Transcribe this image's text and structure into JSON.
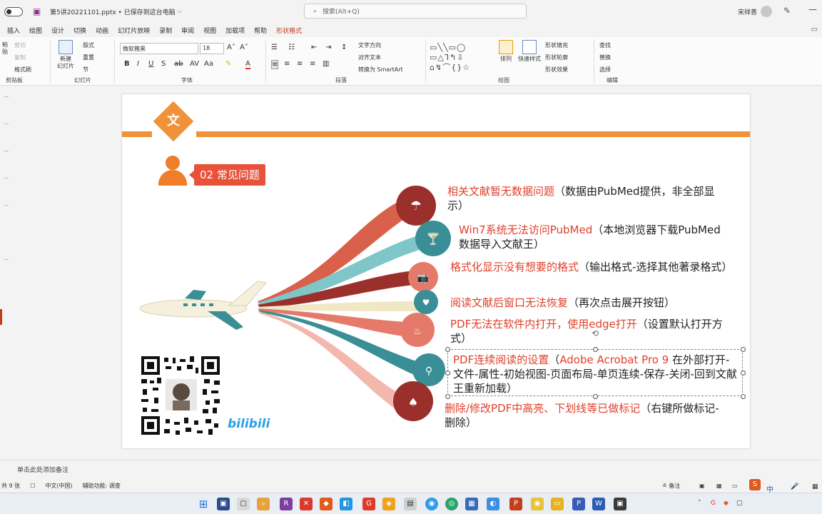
{
  "app": {
    "autosave_label": "关",
    "doc_title": "第5讲20221101.pptx • 已保存到这台电脑",
    "search_placeholder": "搜索(Alt+Q)",
    "user_name": "宋祥善"
  },
  "tabs": [
    "插入",
    "绘图",
    "设计",
    "切换",
    "动画",
    "幻灯片放映",
    "录制",
    "审阅",
    "视图",
    "加载项",
    "帮助",
    "形状格式"
  ],
  "ribbon": {
    "clipboard": {
      "paste": "粘贴",
      "cut": "剪切",
      "copy": "复制",
      "format_painter": "格式刷",
      "label": "剪贴板"
    },
    "slides": {
      "new_slide": "新建\n幻灯片",
      "layout": "版式",
      "reset": "重置",
      "section": "节",
      "label": "幻灯片"
    },
    "font": {
      "family": "微软雅黑",
      "size": "18",
      "label": "字体"
    },
    "paragraph": {
      "text_direction": "文字方向",
      "align_text": "对齐文本",
      "smartart": "转换为 SmartArt",
      "label": "段落"
    },
    "drawing": {
      "arrange": "排列",
      "quick_styles": "快速样式",
      "shape_fill": "形状填充",
      "shape_outline": "形状轮廓",
      "shape_effects": "形状效果",
      "label": "绘图"
    },
    "editing": {
      "find": "查找",
      "replace": "替换",
      "select": "选择",
      "label": "编辑"
    }
  },
  "slide": {
    "badge_char": "文",
    "section_label": "02 常见问题",
    "items": [
      {
        "highlight": "相关文献暂无数据问题",
        "rest": "（数据由PubMed提供，非全部显示）"
      },
      {
        "highlight": "Win7系统无法访问PubMed",
        "rest": "（本地浏览器下载PubMed数据导入文献王）"
      },
      {
        "highlight": "格式化显示没有想要的格式",
        "rest": "（输出格式-选择其他著录格式）"
      },
      {
        "highlight": "阅读文献后窗口无法恢复",
        "rest": "（再次点击展开按钮）"
      },
      {
        "highlight": "PDF无法在软件内打开，使用edge打开",
        "rest": "（设置默认打开方式）"
      },
      {
        "highlight": "PDF连续阅读的设置",
        "rest_a": "（",
        "highlight2": "Adobe Acrobat Pro 9",
        "rest": " 在外部打开-文件-属性-初始视图-页面布局-单页连续-保存-关闭-回到文献王重新加载）"
      },
      {
        "highlight": "删除/修改PDF中高亮、下划线等已做标记",
        "rest": "（右键所做标记-删除）"
      }
    ],
    "bili_text": "bilibili"
  },
  "notes_placeholder": "单击此处添加备注",
  "status": {
    "slide_count": "共 9 张",
    "language": "中文(中国)",
    "accessibility": "辅助功能: 调查",
    "notes_btn": "备注"
  },
  "tray": {
    "ime": "中"
  },
  "colors": {
    "accent": "#c43e1c",
    "orange": "#f0923a",
    "red": "#e0402b",
    "teal": "#3a8f96"
  }
}
